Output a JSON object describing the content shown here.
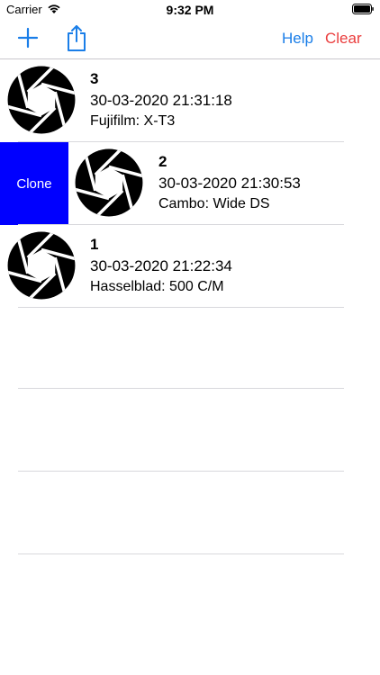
{
  "status": {
    "carrier": "Carrier",
    "time": "9:32 PM"
  },
  "toolbar": {
    "help_label": "Help",
    "clear_label": "Clear",
    "help_color": "#1a7ee8",
    "clear_color": "#ea3d3d"
  },
  "list": {
    "items": [
      {
        "title": "3",
        "date": "30-03-2020 21:31:18",
        "camera": "Fujifilm: X-T3",
        "icon": "aperture-icon"
      },
      {
        "title": "2",
        "date": "30-03-2020 21:30:53",
        "camera": "Cambo: Wide DS",
        "icon": "aperture-icon"
      },
      {
        "title": "1",
        "date": "30-03-2020 21:22:34",
        "camera": "Hasselblad: 500 C/M",
        "icon": "aperture-icon"
      }
    ]
  },
  "swipe_action": {
    "label": "Clone",
    "color": "#0000ff"
  }
}
